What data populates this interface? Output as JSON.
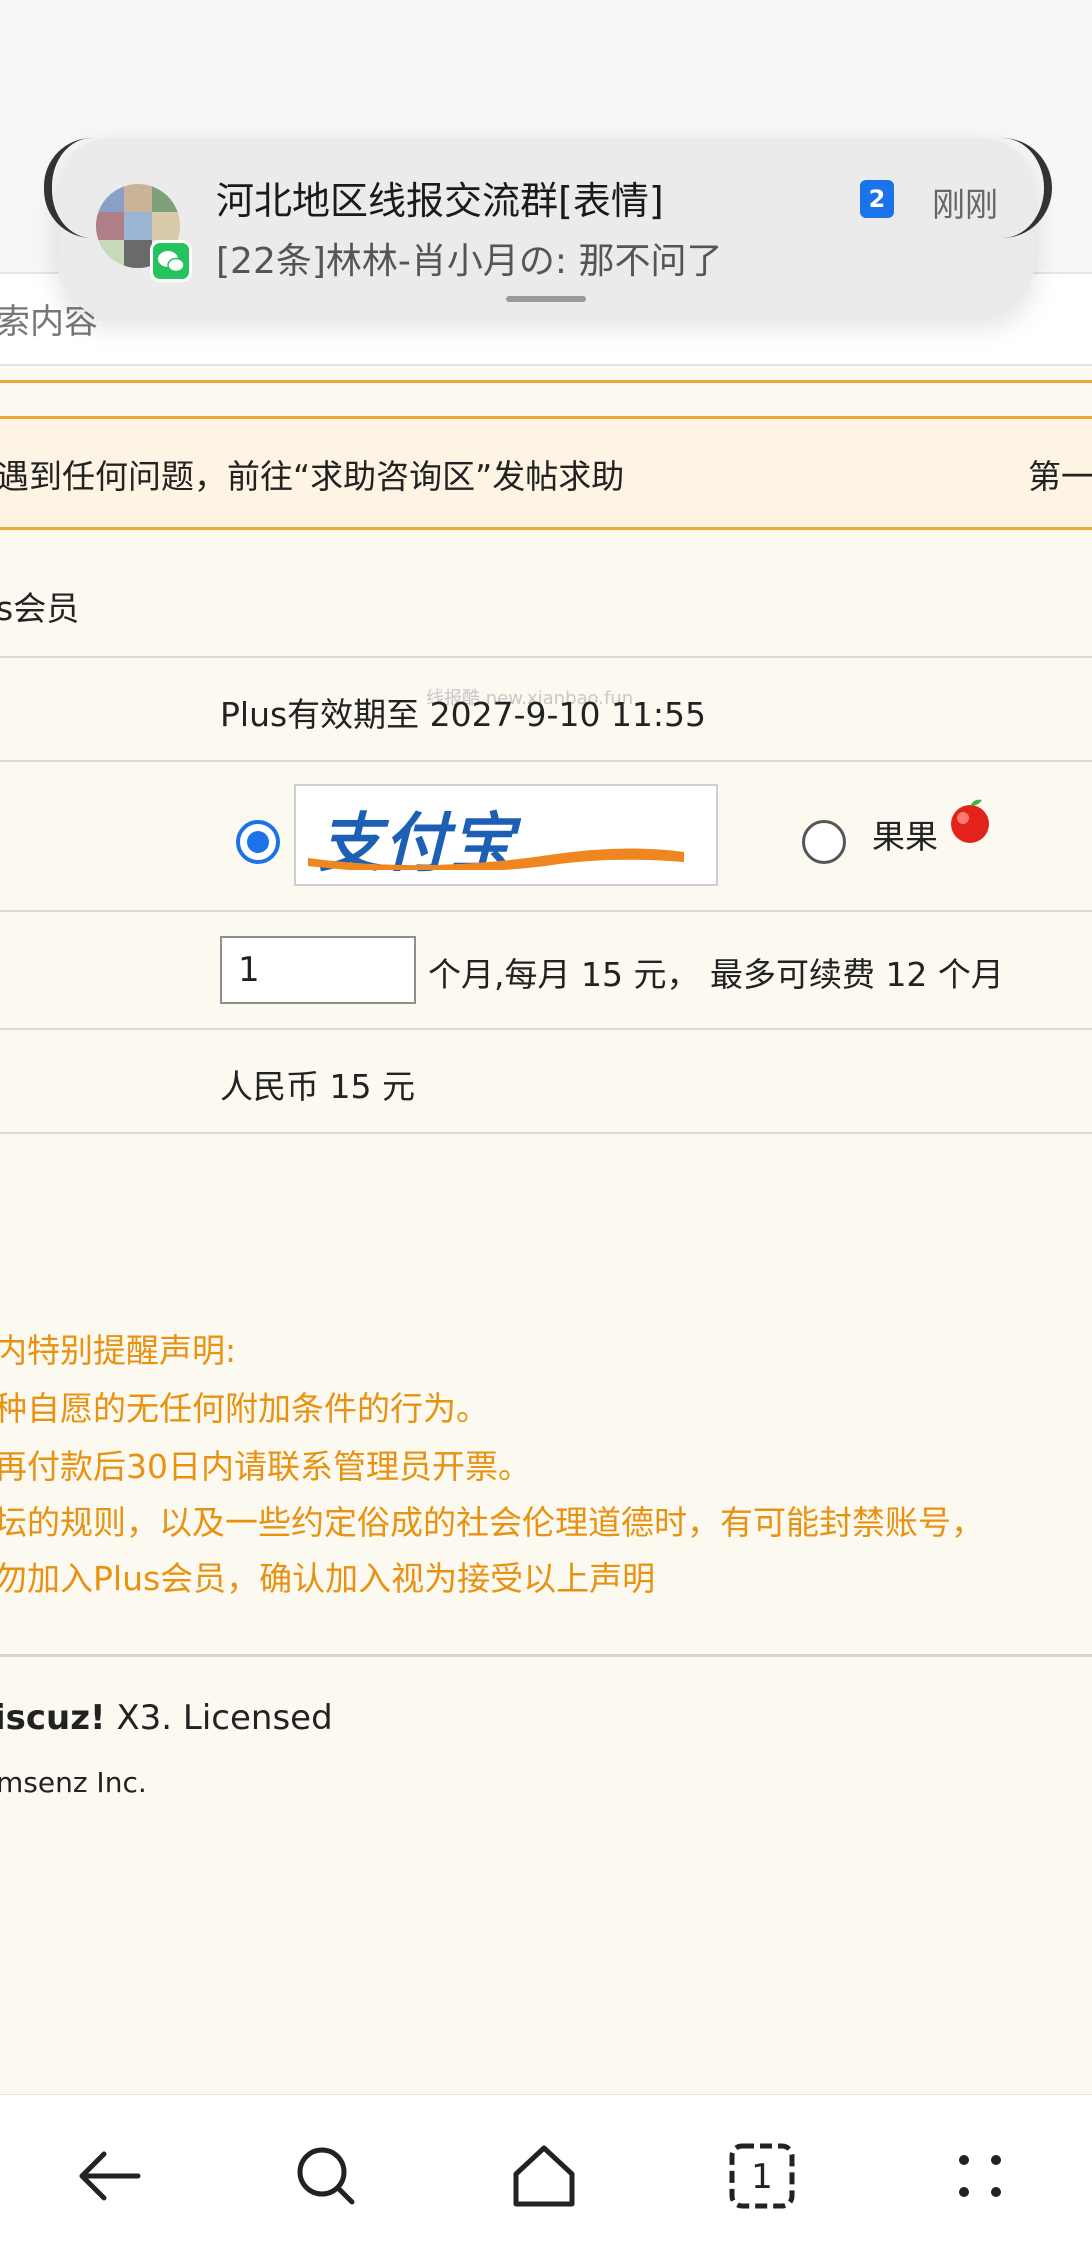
{
  "search": {
    "placeholder_fragment": "索内容"
  },
  "notice": {
    "text": "遇到任何问题，前往“求助咨询区”发帖求助",
    "right_text": "第一"
  },
  "plus": {
    "section_title": "s会员",
    "expiry": "Plus有效期至 2027-9-10 11:55",
    "payment": {
      "selected": "alipay",
      "alipay_alt": "支付宝",
      "alt_label": "果果"
    },
    "quantity": {
      "value": "1",
      "suffix": "个月,每月 15 元， 最多可续费 12 个月"
    },
    "total": "人民币 15 元"
  },
  "declaration": [
    "内特别提醒声明:",
    "种自愿的无任何附加条件的行为。",
    "再付款后30日内请联系管理员开票。",
    "坛的规则，以及一些约定俗成的社会伦理道德时，有可能封禁账号，",
    "勿加入Plus会员，确认加入视为接受以上声明"
  ],
  "footer": {
    "brand": "iscuz!",
    "version": " X3. Licensed",
    "company": "msenz Inc."
  },
  "watermark": "线报酷 new.xianbao.fun",
  "notification": {
    "app": "wechat",
    "title": "河北地区线报交流群[表情]",
    "body": "[22条]林林-肖小月の: 那不问了",
    "count_badge": "2",
    "time": "刚刚"
  },
  "nav": [
    "back-icon",
    "search-icon",
    "home-icon",
    "tabs-icon",
    "more-icon"
  ],
  "nav_tab_count": "1",
  "colors": {
    "accent_orange": "#f0a73a",
    "declaration_text": "#e89212",
    "radio_blue": "#1a73e8",
    "wechat_green": "#25c25d"
  }
}
